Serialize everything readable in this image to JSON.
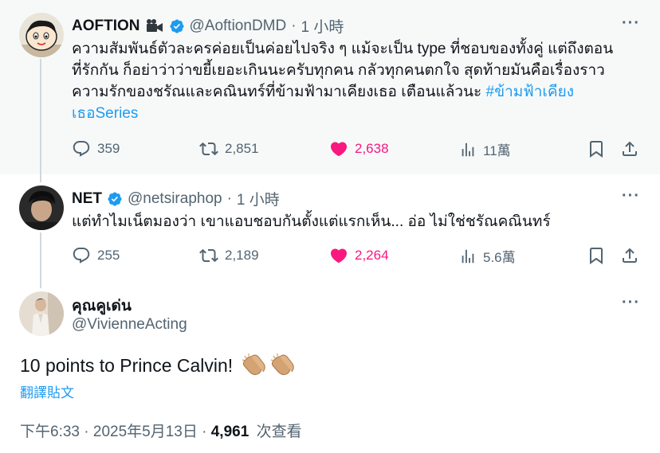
{
  "colors": {
    "accent": "#1d9bf0",
    "like": "#f91880",
    "muted": "#536471",
    "highlight": "#f7f9f9"
  },
  "tweets": [
    {
      "name": "AOFTION",
      "name_emoji": "movie-camera-icon",
      "verified": true,
      "handle": "@AoftionDMD",
      "time": "1 小時",
      "text": "ความสัมพันธ์ตัวละครค่อยเป็นค่อยไปจริง ๆ แม้จะเป็น type ที่ชอบของทั้งคู่ แต่ถึงตอนที่รักกัน ก็อย่าว่าว่าขยี้เยอะเกินนะครับทุกคน กลัวทุกคนตกใจ สุดท้ายมันคือเรื่องราวความรักของชรัณและคณินทร์ที่ข้ามฟ้ามาเคียงเธอ เตือนแล้วนะ ",
      "hashtag": "#ข้ามฟ้าเคียงเธอSeries",
      "replies": "359",
      "reposts": "2,851",
      "likes": "2,638",
      "views": "11萬"
    },
    {
      "name": "NET",
      "verified": true,
      "handle": "@netsiraphop",
      "time": "1 小時",
      "text": "แต่ทำไมเน็ตมองว่า เขาแอบชอบกันตั้งแต่แรกเห็น... อ่อ ไม่ใช่ชรัณคณินทร์",
      "replies": "255",
      "reposts": "2,189",
      "likes": "2,264",
      "views": "5.6萬"
    }
  ],
  "main": {
    "name": "คุณคูเด่น",
    "handle": "@VivienneActing",
    "text": "10 points to Prince Calvin!",
    "emoji": [
      "clapping-hands-icon",
      "clapping-hands-icon"
    ],
    "translate": "翻譯貼文",
    "time": "下午6:33",
    "date": "2025年5月13日",
    "views_count": "4,961",
    "views_label": "次查看"
  }
}
